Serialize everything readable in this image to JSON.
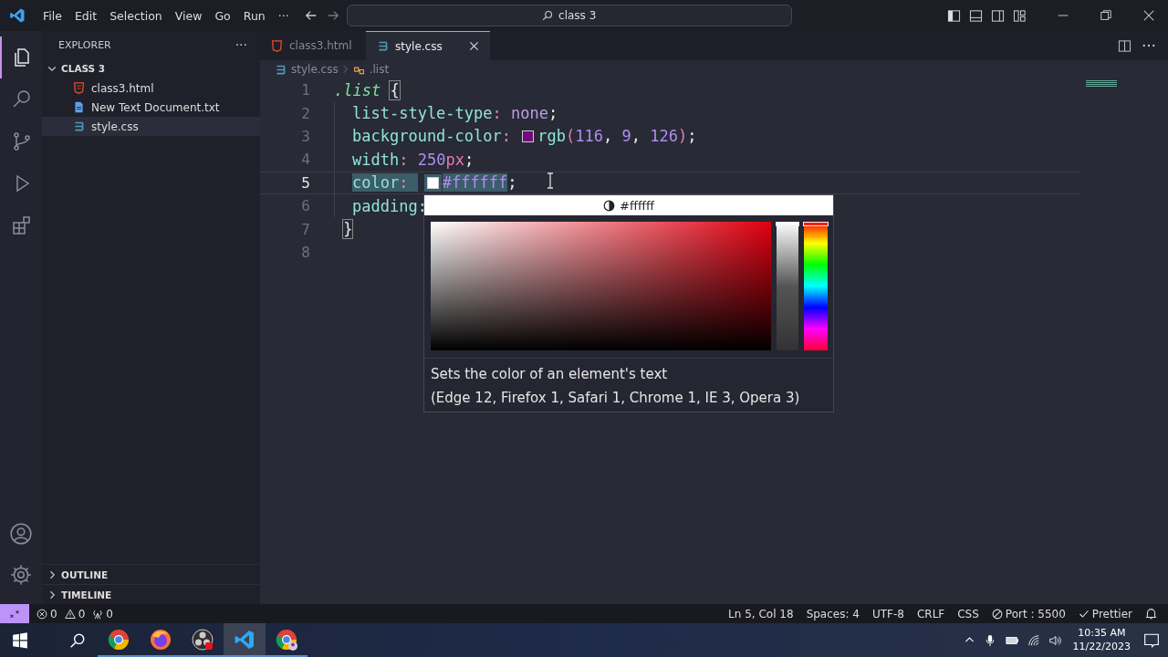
{
  "title_bar": {
    "menu": [
      "File",
      "Edit",
      "Selection",
      "View",
      "Go",
      "Run",
      "···"
    ],
    "search": "class 3"
  },
  "activity_bar": [
    {
      "kind": "files",
      "selected": true
    },
    {
      "kind": "search",
      "selected": false
    },
    {
      "kind": "source-control",
      "selected": false
    },
    {
      "kind": "run",
      "selected": false
    },
    {
      "kind": "extensions",
      "selected": false
    }
  ],
  "sidebar": {
    "title": "EXPLORER",
    "more": "···",
    "folder": {
      "label": "CLASS 3",
      "expanded": true,
      "children": [
        {
          "name": "class3.html",
          "kind": "html",
          "selected": false
        },
        {
          "name": "New Text Document.txt",
          "kind": "txt",
          "selected": false
        },
        {
          "name": "style.css",
          "kind": "css",
          "selected": true
        }
      ]
    },
    "sections": [
      {
        "label": "OUTLINE",
        "expanded": false
      },
      {
        "label": "TIMELINE",
        "expanded": false
      }
    ]
  },
  "tabs": [
    {
      "label": "class3.html",
      "kind": "html",
      "selected": false
    },
    {
      "label": "style.css",
      "kind": "css",
      "selected": true
    }
  ],
  "breadcrumb": [
    {
      "label": "style.css",
      "kind": "css"
    },
    {
      "label": ".list",
      "kind": "symbol"
    }
  ],
  "editor": {
    "lines": [
      {
        "number": "1",
        "current": false,
        "indented": false,
        "tokens": [
          {
            "t": ".list",
            "kind": "selector"
          },
          {
            "t": "{",
            "kind": "brace"
          }
        ]
      },
      {
        "number": "2",
        "current": false,
        "indented": true,
        "tokens": [
          {
            "t": "list-style-type",
            "kind": "prop"
          },
          {
            "t": ": ",
            "kind": "colon"
          },
          {
            "t": "none",
            "kind": "value"
          },
          {
            "t": ";",
            "kind": "punct"
          }
        ]
      },
      {
        "number": "3",
        "current": false,
        "indented": true,
        "tokens": [
          {
            "t": "background-color",
            "kind": "prop"
          },
          {
            "t": ": ",
            "kind": "colon"
          },
          {
            "kind": "swatch",
            "color": "#74097e"
          },
          {
            "t": "rgb",
            "kind": "func"
          },
          {
            "t": "(",
            "kind": "paren"
          },
          {
            "t": "116",
            "kind": "number"
          },
          {
            "t": ", ",
            "kind": "punct"
          },
          {
            "t": "9",
            "kind": "number"
          },
          {
            "t": ", ",
            "kind": "punct"
          },
          {
            "t": "126",
            "kind": "number"
          },
          {
            "t": ")",
            "kind": "paren"
          },
          {
            "t": ";",
            "kind": "punct"
          }
        ]
      },
      {
        "number": "4",
        "current": false,
        "indented": true,
        "tokens": [
          {
            "t": "width",
            "kind": "prop"
          },
          {
            "t": ": ",
            "kind": "colon"
          },
          {
            "t": "250",
            "kind": "number"
          },
          {
            "t": "px",
            "kind": "unit"
          },
          {
            "t": ";",
            "kind": "punct"
          }
        ]
      },
      {
        "number": "5",
        "current": true,
        "indented": true,
        "tokens": [
          {
            "t": "color",
            "kind": "prop",
            "highlighted": true
          },
          {
            "t": ": ",
            "kind": "colon",
            "highlighted": true
          },
          {
            "kind": "swatch",
            "color": "#ffffff",
            "highlighted": true
          },
          {
            "t": "#ffffff",
            "kind": "number",
            "highlighted": true
          },
          {
            "t": ";",
            "kind": "punct",
            "highlighted": false
          }
        ]
      },
      {
        "number": "6",
        "current": false,
        "indented": true,
        "tokens": [
          {
            "t": "padding:",
            "kind": "prop"
          }
        ]
      },
      {
        "number": "7",
        "current": false,
        "indented": false,
        "tokens": [
          {
            "t": "}",
            "kind": "brace"
          }
        ]
      },
      {
        "number": "8",
        "current": false,
        "indented": false
      }
    ]
  },
  "hover": {
    "header": "#ffffff",
    "opacity": {
      "level": 1
    },
    "hue": {
      "level": 0
    },
    "description": "Sets the color of an element's text",
    "compat": "(Edge 12, Firefox 1, Safari 1, Chrome 1, IE 3, Opera 3)"
  },
  "status_bar": {
    "left": [
      {
        "kind": "error",
        "text": "0"
      },
      {
        "kind": "warning",
        "text": "0"
      },
      {
        "kind": "ports",
        "text": "0"
      }
    ],
    "right": [
      {
        "kind": "plain",
        "text": "Ln 5, Col 18"
      },
      {
        "kind": "plain",
        "text": "Spaces: 4"
      },
      {
        "kind": "plain",
        "text": "UTF-8"
      },
      {
        "kind": "plain",
        "text": "CRLF"
      },
      {
        "kind": "plain",
        "text": "CSS"
      },
      {
        "kind": "port",
        "text": "Port : 5500"
      },
      {
        "kind": "check",
        "text": "Prettier"
      },
      {
        "kind": "bell"
      }
    ]
  },
  "taskbar": {
    "apps": [
      {
        "kind": "chrome",
        "selected": false
      },
      {
        "kind": "firefox",
        "selected": false
      },
      {
        "kind": "obs",
        "selected": false
      },
      {
        "kind": "vscode",
        "selected": true
      },
      {
        "kind": "chrome-profile",
        "selected": false
      }
    ],
    "clock": {
      "time": "10:35 AM",
      "date": "11/22/2023"
    }
  }
}
